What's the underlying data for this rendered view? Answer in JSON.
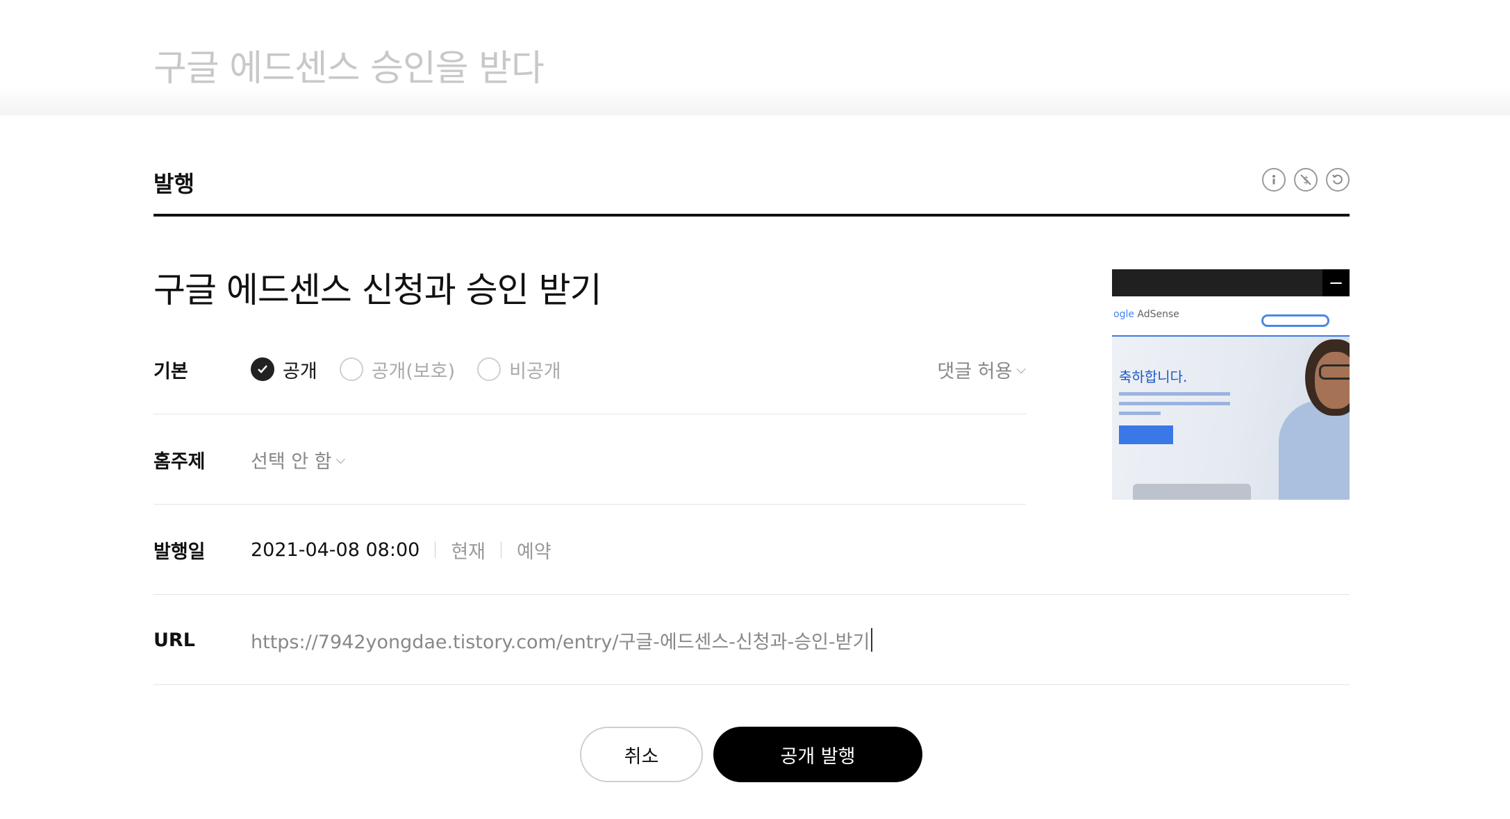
{
  "editor": {
    "title_placeholder": "구글 에드센스 승인을 받다"
  },
  "publish_panel": {
    "title": "발행",
    "head_icons": [
      "info-icon",
      "no-ads-icon",
      "history-icon"
    ],
    "post_title": "구글 에드센스 신청과 승인 받기",
    "visibility": {
      "label": "기본",
      "options": [
        {
          "label": "공개",
          "checked": true
        },
        {
          "label": "공개(보호)",
          "checked": false
        },
        {
          "label": "비공개",
          "checked": false
        }
      ],
      "comment_setting": "댓글 허용"
    },
    "topic": {
      "label": "홈주제",
      "value": "선택 안 함"
    },
    "publish_date": {
      "label": "발행일",
      "value": "2021-04-08 08:00",
      "now_label": "현재",
      "reserve_label": "예약"
    },
    "url": {
      "label": "URL",
      "value": "https://7942yongdae.tistory.com/entry/구글-에드센스-신청과-승인-받기"
    },
    "thumbnail": {
      "remove_symbol": "−",
      "adsense_logo_prefix": "ogle",
      "adsense_logo_suffix": " AdSense",
      "headline": "축하합니다."
    }
  },
  "actions": {
    "cancel_label": "취소",
    "publish_label": "공개 발행"
  },
  "colors": {
    "primary": "#000000",
    "accent_blue": "#3b78e7",
    "muted": "#888888"
  }
}
